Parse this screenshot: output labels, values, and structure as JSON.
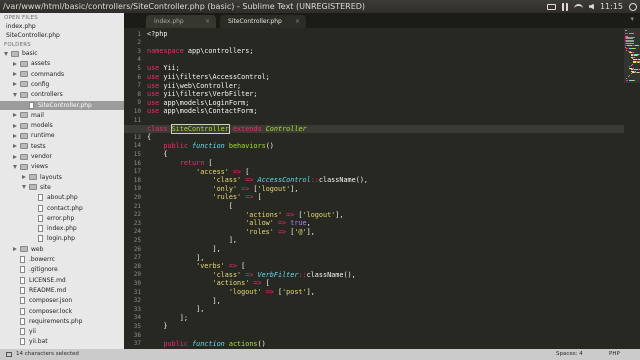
{
  "window": {
    "title": "/var/www/html/basic/controllers/SiteController.php (basic) - Sublime Text (UNREGISTERED)",
    "clock": "11:15"
  },
  "sidebar": {
    "open_files_header": "OPEN FILES",
    "folders_header": "FOLDERS",
    "open_files": [
      "index.php",
      "SiteController.php"
    ],
    "tree": [
      {
        "label": "basic",
        "depth": 0,
        "kind": "folder",
        "state": "open"
      },
      {
        "label": "assets",
        "depth": 1,
        "kind": "folder",
        "state": "closed"
      },
      {
        "label": "commands",
        "depth": 1,
        "kind": "folder",
        "state": "closed"
      },
      {
        "label": "config",
        "depth": 1,
        "kind": "folder",
        "state": "closed"
      },
      {
        "label": "controllers",
        "depth": 1,
        "kind": "folder",
        "state": "open"
      },
      {
        "label": "SiteController.php",
        "depth": 2,
        "kind": "file",
        "selected": true
      },
      {
        "label": "mail",
        "depth": 1,
        "kind": "folder",
        "state": "closed"
      },
      {
        "label": "models",
        "depth": 1,
        "kind": "folder",
        "state": "closed"
      },
      {
        "label": "runtime",
        "depth": 1,
        "kind": "folder",
        "state": "closed"
      },
      {
        "label": "tests",
        "depth": 1,
        "kind": "folder",
        "state": "closed"
      },
      {
        "label": "vendor",
        "depth": 1,
        "kind": "folder",
        "state": "closed"
      },
      {
        "label": "views",
        "depth": 1,
        "kind": "folder",
        "state": "open"
      },
      {
        "label": "layouts",
        "depth": 2,
        "kind": "folder",
        "state": "closed"
      },
      {
        "label": "site",
        "depth": 2,
        "kind": "folder",
        "state": "open"
      },
      {
        "label": "about.php",
        "depth": 3,
        "kind": "file"
      },
      {
        "label": "contact.php",
        "depth": 3,
        "kind": "file"
      },
      {
        "label": "error.php",
        "depth": 3,
        "kind": "file"
      },
      {
        "label": "index.php",
        "depth": 3,
        "kind": "file"
      },
      {
        "label": "login.php",
        "depth": 3,
        "kind": "file"
      },
      {
        "label": "web",
        "depth": 1,
        "kind": "folder",
        "state": "closed"
      },
      {
        "label": ".bowerrc",
        "depth": 1,
        "kind": "file"
      },
      {
        "label": ".gitignore",
        "depth": 1,
        "kind": "file"
      },
      {
        "label": "LICENSE.md",
        "depth": 1,
        "kind": "file"
      },
      {
        "label": "README.md",
        "depth": 1,
        "kind": "file"
      },
      {
        "label": "composer.json",
        "depth": 1,
        "kind": "file"
      },
      {
        "label": "composer.lock",
        "depth": 1,
        "kind": "file"
      },
      {
        "label": "requirements.php",
        "depth": 1,
        "kind": "file"
      },
      {
        "label": "yii",
        "depth": 1,
        "kind": "file"
      },
      {
        "label": "yii.bat",
        "depth": 1,
        "kind": "file"
      }
    ]
  },
  "tabs": [
    {
      "label": "index.php",
      "close": "×"
    },
    {
      "label": "SiteController.php",
      "close": "×"
    }
  ],
  "tab_overflow": "▾",
  "editor": {
    "highlighted_line": 12,
    "lines": [
      {
        "n": "1",
        "t": [
          [
            "<?php",
            ""
          ]
        ]
      },
      {
        "n": "2",
        "t": []
      },
      {
        "n": "3",
        "t": [
          [
            "namespace",
            "kw"
          ],
          [
            " app\\controllers;",
            ""
          ]
        ]
      },
      {
        "n": "4",
        "t": []
      },
      {
        "n": "5",
        "t": [
          [
            "use",
            "kw"
          ],
          [
            " Yii;",
            ""
          ]
        ]
      },
      {
        "n": "6",
        "t": [
          [
            "use",
            "kw"
          ],
          [
            " yii\\filters\\AccessControl;",
            ""
          ]
        ]
      },
      {
        "n": "7",
        "t": [
          [
            "use",
            "kw"
          ],
          [
            " yii\\web\\Controller;",
            ""
          ]
        ]
      },
      {
        "n": "8",
        "t": [
          [
            "use",
            "kw"
          ],
          [
            " yii\\filters\\VerbFilter;",
            ""
          ]
        ]
      },
      {
        "n": "9",
        "t": [
          [
            "use",
            "kw"
          ],
          [
            " app\\models\\LoginForm;",
            ""
          ]
        ]
      },
      {
        "n": "10",
        "t": [
          [
            "use",
            "kw"
          ],
          [
            " app\\models\\ContactForm;",
            ""
          ]
        ]
      },
      {
        "n": "11",
        "t": []
      },
      {
        "n": "12",
        "t": [
          [
            "class",
            "kw"
          ],
          [
            " ",
            ""
          ],
          [
            "SiteController",
            "fn sel"
          ],
          [
            " ",
            ""
          ],
          [
            "extends",
            "kw"
          ],
          [
            " ",
            ""
          ],
          [
            "Controller",
            "ex"
          ]
        ]
      },
      {
        "n": "13",
        "t": [
          [
            "{",
            ""
          ]
        ]
      },
      {
        "n": "14",
        "t": [
          [
            "    ",
            ""
          ],
          [
            "public",
            "kw"
          ],
          [
            " ",
            ""
          ],
          [
            "function",
            "it"
          ],
          [
            " ",
            ""
          ],
          [
            "behaviors",
            "fn"
          ],
          [
            "()",
            ""
          ]
        ]
      },
      {
        "n": "15",
        "t": [
          [
            "    {",
            ""
          ]
        ]
      },
      {
        "n": "16",
        "t": [
          [
            "        ",
            ""
          ],
          [
            "return",
            "kw"
          ],
          [
            " [",
            ""
          ]
        ]
      },
      {
        "n": "17",
        "t": [
          [
            "            ",
            ""
          ],
          [
            "'access'",
            "st"
          ],
          [
            " ",
            ""
          ],
          [
            "=>",
            "kw"
          ],
          [
            " [",
            ""
          ]
        ]
      },
      {
        "n": "18",
        "t": [
          [
            "                ",
            ""
          ],
          [
            "'class'",
            "st"
          ],
          [
            " ",
            ""
          ],
          [
            "=>",
            "kw"
          ],
          [
            " ",
            ""
          ],
          [
            "AccessControl",
            "ty"
          ],
          [
            "::",
            "kw"
          ],
          [
            "className(),",
            ""
          ]
        ]
      },
      {
        "n": "19",
        "t": [
          [
            "                ",
            ""
          ],
          [
            "'only'",
            "st"
          ],
          [
            " ",
            ""
          ],
          [
            "=>",
            "kw"
          ],
          [
            " [",
            ""
          ],
          [
            "'logout'",
            "st"
          ],
          [
            "],",
            ""
          ]
        ]
      },
      {
        "n": "20",
        "t": [
          [
            "                ",
            ""
          ],
          [
            "'rules'",
            "st"
          ],
          [
            " ",
            ""
          ],
          [
            "=>",
            "kw"
          ],
          [
            " [",
            ""
          ]
        ]
      },
      {
        "n": "21",
        "t": [
          [
            "                    [",
            ""
          ]
        ]
      },
      {
        "n": "22",
        "t": [
          [
            "                        ",
            ""
          ],
          [
            "'actions'",
            "st"
          ],
          [
            " ",
            ""
          ],
          [
            "=>",
            "kw"
          ],
          [
            " [",
            ""
          ],
          [
            "'logout'",
            "st"
          ],
          [
            "],",
            ""
          ]
        ]
      },
      {
        "n": "23",
        "t": [
          [
            "                        ",
            ""
          ],
          [
            "'allow'",
            "st"
          ],
          [
            " ",
            ""
          ],
          [
            "=>",
            "kw"
          ],
          [
            " ",
            ""
          ],
          [
            "true",
            "cn"
          ],
          [
            ",",
            ""
          ]
        ]
      },
      {
        "n": "24",
        "t": [
          [
            "                        ",
            ""
          ],
          [
            "'roles'",
            "st"
          ],
          [
            " ",
            ""
          ],
          [
            "=>",
            "kw"
          ],
          [
            " [",
            ""
          ],
          [
            "'@'",
            "st"
          ],
          [
            "],",
            ""
          ]
        ]
      },
      {
        "n": "25",
        "t": [
          [
            "                    ],",
            ""
          ]
        ]
      },
      {
        "n": "26",
        "t": [
          [
            "                ],",
            ""
          ]
        ]
      },
      {
        "n": "27",
        "t": [
          [
            "            ],",
            ""
          ]
        ]
      },
      {
        "n": "28",
        "t": [
          [
            "            ",
            ""
          ],
          [
            "'verbs'",
            "st"
          ],
          [
            " ",
            ""
          ],
          [
            "=>",
            "kw"
          ],
          [
            " [",
            ""
          ]
        ]
      },
      {
        "n": "29",
        "t": [
          [
            "                ",
            ""
          ],
          [
            "'class'",
            "st"
          ],
          [
            " ",
            ""
          ],
          [
            "=>",
            "kw"
          ],
          [
            " ",
            ""
          ],
          [
            "VerbFilter",
            "ty"
          ],
          [
            "::",
            "kw"
          ],
          [
            "className(),",
            ""
          ]
        ]
      },
      {
        "n": "30",
        "t": [
          [
            "                ",
            ""
          ],
          [
            "'actions'",
            "st"
          ],
          [
            " ",
            ""
          ],
          [
            "=>",
            "kw"
          ],
          [
            " [",
            ""
          ]
        ]
      },
      {
        "n": "31",
        "t": [
          [
            "                    ",
            ""
          ],
          [
            "'logout'",
            "st"
          ],
          [
            " ",
            ""
          ],
          [
            "=>",
            "kw"
          ],
          [
            " [",
            ""
          ],
          [
            "'post'",
            "st"
          ],
          [
            "],",
            ""
          ]
        ]
      },
      {
        "n": "32",
        "t": [
          [
            "                ],",
            ""
          ]
        ]
      },
      {
        "n": "33",
        "t": [
          [
            "            ],",
            ""
          ]
        ]
      },
      {
        "n": "34",
        "t": [
          [
            "        ];",
            ""
          ]
        ]
      },
      {
        "n": "35",
        "t": [
          [
            "    }",
            ""
          ]
        ]
      },
      {
        "n": "36",
        "t": []
      },
      {
        "n": "37",
        "t": [
          [
            "    ",
            ""
          ],
          [
            "public",
            "kw"
          ],
          [
            " ",
            ""
          ],
          [
            "function",
            "it"
          ],
          [
            " ",
            ""
          ],
          [
            "actions",
            "fn"
          ],
          [
            "()",
            ""
          ]
        ]
      }
    ]
  },
  "statusbar": {
    "selection": "14 characters selected",
    "indent": "Spaces: 4",
    "syntax": "PHP"
  },
  "colors": {
    "background": "#272822",
    "keyword": "#f92672",
    "string": "#e6db74",
    "function": "#a6e22e",
    "type": "#66d9ef",
    "constant": "#ae81ff"
  },
  "icons": [
    "mail-icon",
    "bluetooth-icon",
    "wifi-icon",
    "volume-icon",
    "power-icon",
    "folder-icon",
    "file-icon"
  ]
}
